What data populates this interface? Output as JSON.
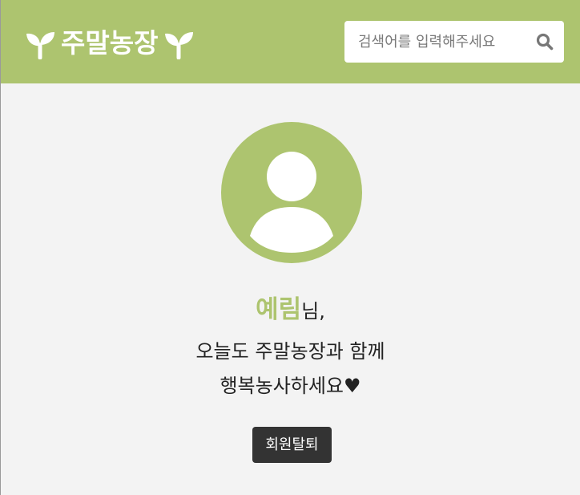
{
  "header": {
    "brand_title": "주말농장",
    "brand_icon_left": "seedling-icon",
    "brand_icon_right": "seedling-icon",
    "search": {
      "placeholder": "검색어를 입력해주세요",
      "value": "",
      "button_icon": "search-icon"
    }
  },
  "profile": {
    "avatar_icon": "user-avatar-icon",
    "username": "예림",
    "honorific": "님,",
    "message_line1": "오늘도 주말농장과 함께",
    "message_line2": "행복농사하세요♥",
    "withdraw_label": "회원탈퇴"
  },
  "colors": {
    "brand_green": "#adc46f",
    "background": "#f3f3f3",
    "button_dark": "#333333",
    "text_dark": "#222222"
  }
}
